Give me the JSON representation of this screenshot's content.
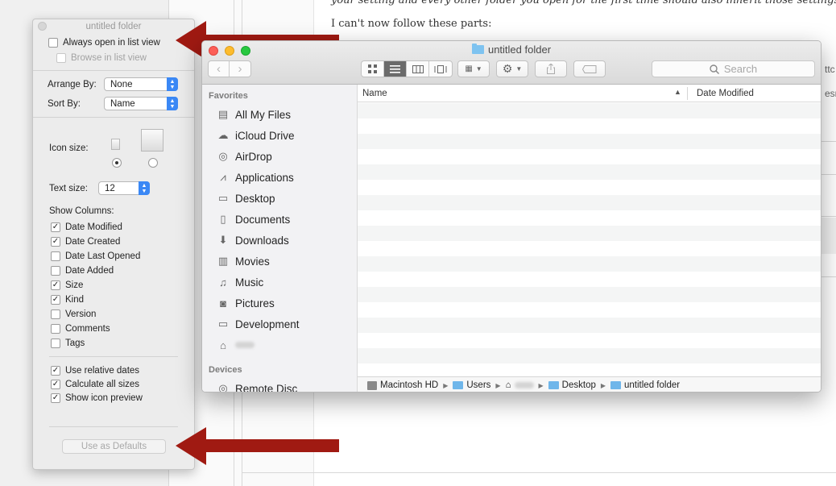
{
  "background": {
    "line1": "your setting and every other folder you open for the first time should also inherit those settings.",
    "line2": "I can't now follow these parts:",
    "edge1": "ttc",
    "edge2": "esn"
  },
  "view_options": {
    "title": "untitled folder",
    "always_open_list": "Always open in list view",
    "browse_list": "Browse in list view",
    "arrange_by_label": "Arrange By:",
    "arrange_by_value": "None",
    "sort_by_label": "Sort By:",
    "sort_by_value": "Name",
    "icon_size_label": "Icon size:",
    "text_size_label": "Text size:",
    "text_size_value": "12",
    "show_columns_label": "Show Columns:",
    "columns": [
      {
        "label": "Date Modified",
        "checked": true
      },
      {
        "label": "Date Created",
        "checked": true
      },
      {
        "label": "Date Last Opened",
        "checked": false
      },
      {
        "label": "Date Added",
        "checked": false
      },
      {
        "label": "Size",
        "checked": true
      },
      {
        "label": "Kind",
        "checked": true
      },
      {
        "label": "Version",
        "checked": false
      },
      {
        "label": "Comments",
        "checked": false
      },
      {
        "label": "Tags",
        "checked": false
      }
    ],
    "options": [
      {
        "label": "Use relative dates",
        "checked": true
      },
      {
        "label": "Calculate all sizes",
        "checked": true
      },
      {
        "label": "Show icon preview",
        "checked": true
      }
    ],
    "defaults_button": "Use as Defaults"
  },
  "finder": {
    "title": "untitled folder",
    "search_placeholder": "Search",
    "sidebar": {
      "favorites_header": "Favorites",
      "favorites": [
        "All My Files",
        "iCloud Drive",
        "AirDrop",
        "Applications",
        "Desktop",
        "Documents",
        "Downloads",
        "Movies",
        "Music",
        "Pictures",
        "Development"
      ],
      "devices_header": "Devices",
      "devices": [
        "Remote Disc"
      ]
    },
    "columns": {
      "name": "Name",
      "date_modified": "Date Modified"
    },
    "path": [
      "Macintosh HD",
      "Users",
      "Desktop",
      "untitled folder"
    ]
  },
  "colors": {
    "accent": "#3b88f5",
    "arrow": "#a01a12",
    "close": "#fc5f57",
    "minimize": "#fdbc2e",
    "zoom": "#28c840"
  }
}
